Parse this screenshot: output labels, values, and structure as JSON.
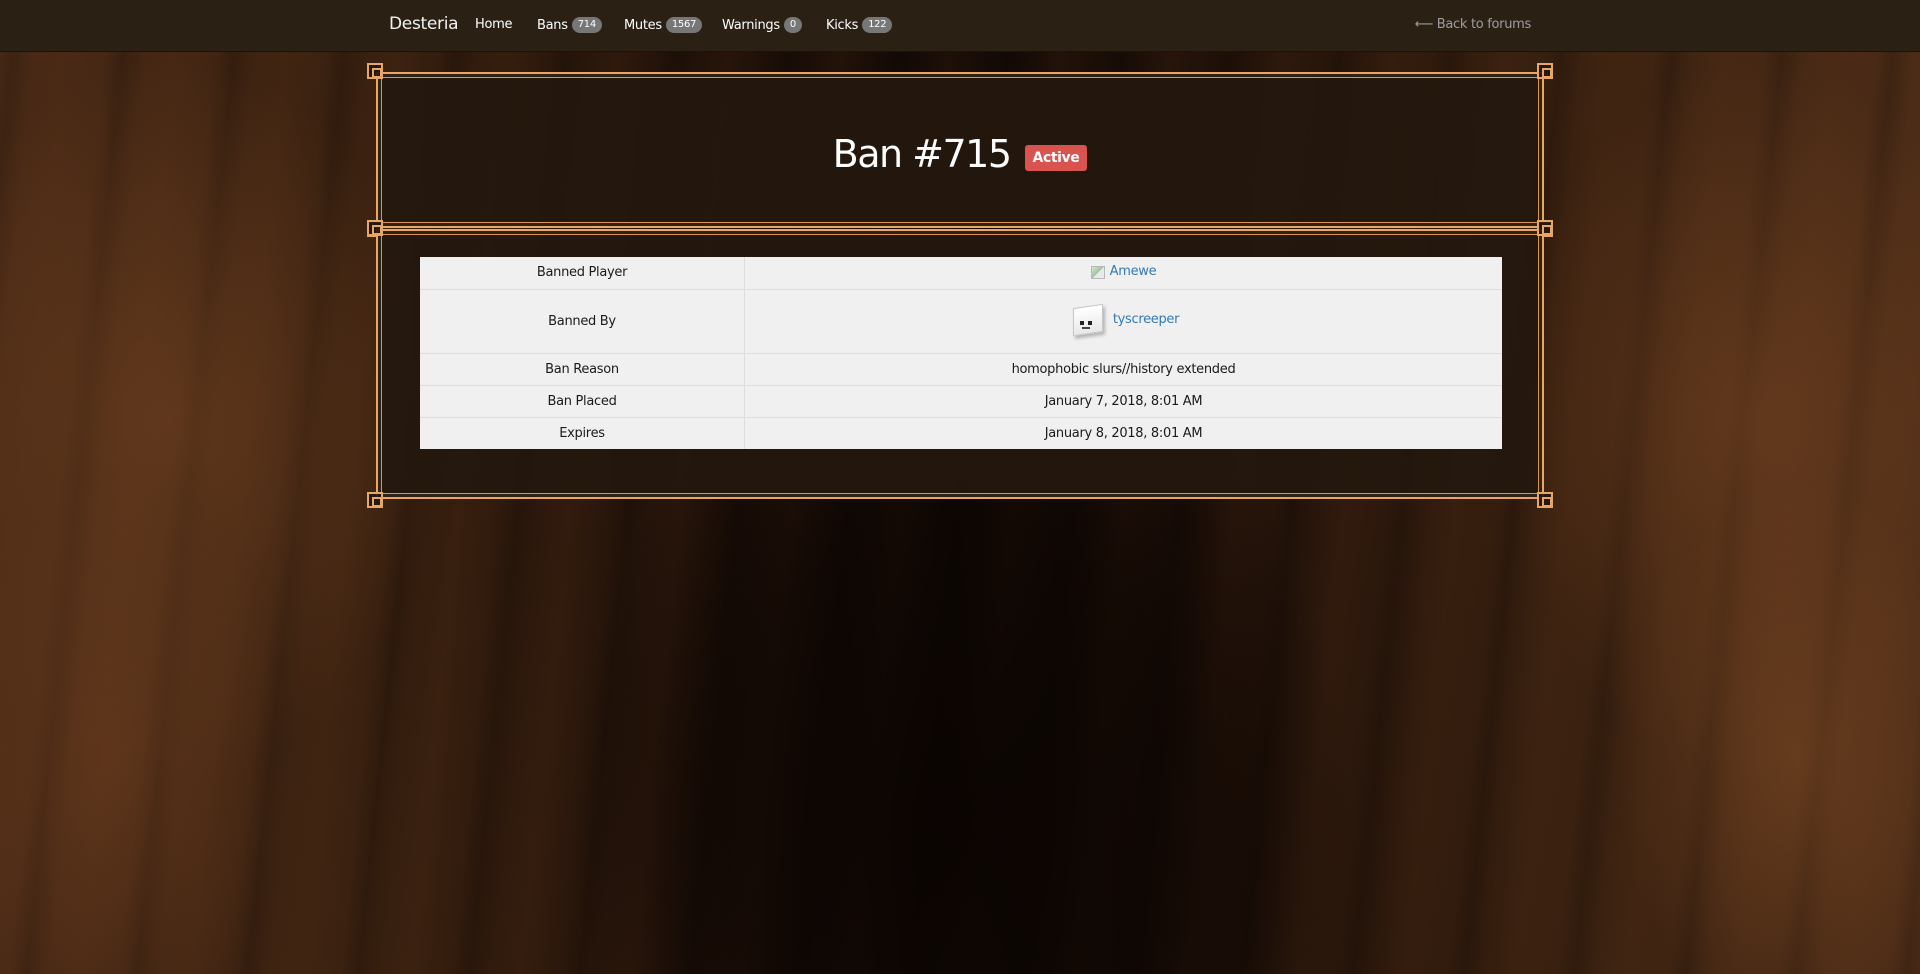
{
  "nav": {
    "brand": "Desteria",
    "items": [
      {
        "label": "Home"
      },
      {
        "label": "Bans",
        "badge": "714"
      },
      {
        "label": "Mutes",
        "badge": "1567"
      },
      {
        "label": "Warnings",
        "badge": "0"
      },
      {
        "label": "Kicks",
        "badge": "122"
      }
    ],
    "back_link": "⟵ Back to forums"
  },
  "heading": {
    "title": "Ban #715",
    "status": "Active"
  },
  "table": {
    "rows": [
      {
        "label": "Banned Player",
        "value": "Amewe"
      },
      {
        "label": "Banned By",
        "value": "tyscreeper"
      },
      {
        "label": "Ban Reason",
        "value": "homophobic slurs//history extended"
      },
      {
        "label": "Ban Placed",
        "value": "January 7, 2018, 8:01 AM"
      },
      {
        "label": "Expires",
        "value": "January 8, 2018, 8:01 AM"
      }
    ]
  },
  "colors": {
    "frame_accent": "#e6a766",
    "status_active": "#d9534f",
    "link": "#337ab7",
    "navbar_bg": "#2b2014"
  },
  "icons": {
    "player_head": "broken-image-icon",
    "staff_avatar": "avatar-icon"
  }
}
